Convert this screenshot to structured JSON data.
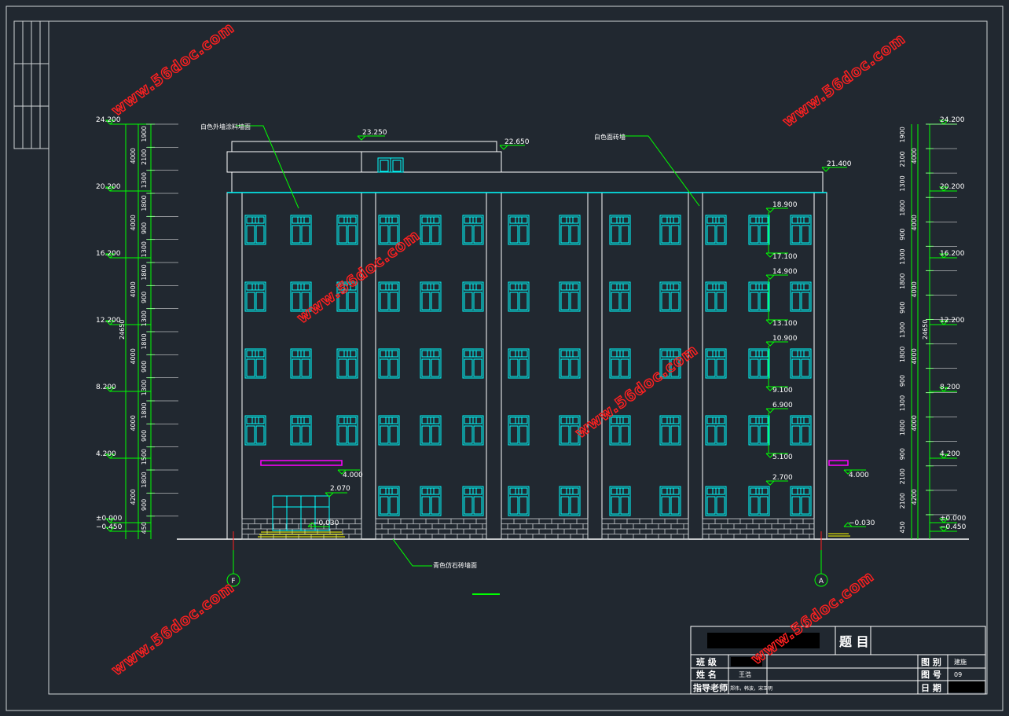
{
  "levels_left": [
    "24.200",
    "20.200",
    "16.200",
    "12.200",
    "8.200",
    "4.200",
    "±0.000",
    "−0.450"
  ],
  "levels_right": [
    "24.200",
    "20.200",
    "16.200",
    "12.200",
    "8.200",
    "4.200",
    "±0.000",
    "−0.450"
  ],
  "dims_left": [
    "1900",
    "2100",
    "1300",
    "1800",
    "900",
    "1300",
    "1800",
    "900",
    "1300",
    "1800",
    "900",
    "1300",
    "1800",
    "900",
    "1500",
    "1800",
    "900",
    "450"
  ],
  "dims_left_mid": [
    "4000",
    "4000",
    "4000",
    "4000",
    "4000",
    "4200"
  ],
  "dims_right": [
    "1900",
    "2100",
    "1300",
    "1800",
    "900",
    "1300",
    "1800",
    "900",
    "1300",
    "1800",
    "900",
    "1300",
    "1800",
    "900",
    "2100",
    "2100",
    "450"
  ],
  "dims_right_mid": [
    "4000",
    "4000",
    "4000",
    "4000",
    "4000",
    "4200"
  ],
  "total_height": "24650",
  "elev_top": [
    "23.250",
    "22.650",
    "21.400"
  ],
  "elev_windows": [
    "18.900",
    "17.100",
    "14.900",
    "13.100",
    "10.900",
    "9.100",
    "6.900",
    "5.100",
    "2.700"
  ],
  "elev_canopy": "4.000",
  "elev_door": "2.070",
  "elev_entry": "−0.030",
  "elev_right_canopy": "4.000",
  "elev_right_ground": "−0.030",
  "notes": [
    "白色外墙涂料墙面",
    "白色面砖墙",
    "青色仿石砖墙面"
  ],
  "axes": [
    "F",
    "A"
  ],
  "watermark": "www.56doc.com",
  "title_block": {
    "title_label": "题 目",
    "class_label": "班 级",
    "name_label": "姓 名",
    "name_value": "王浩",
    "advisor_label": "指导老师",
    "advisor_value": "郑伟，韩波，宋玉明",
    "drawing_type_label": "图 别",
    "drawing_type_value": "建施",
    "drawing_no_label": "图 号",
    "drawing_no_value": "09",
    "date_label": "日 期"
  },
  "colors": {
    "background": "#212830",
    "cyan": "#00ffff",
    "green": "#00ff00",
    "magenta": "#ff00ff",
    "yellow": "#ffff00",
    "red": "#ff0000",
    "white": "#ffffff"
  }
}
